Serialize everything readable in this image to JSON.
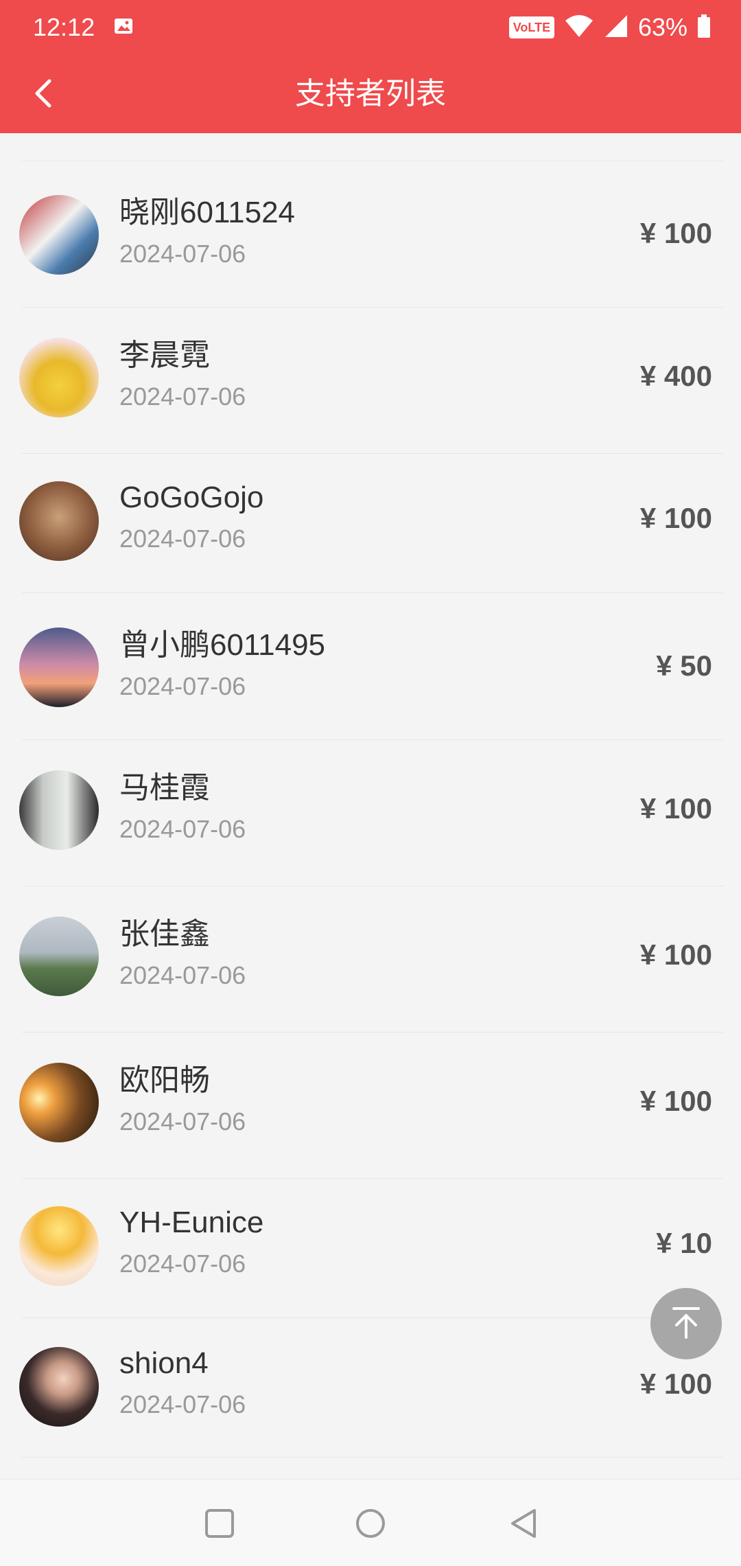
{
  "status_bar": {
    "time": "12:12",
    "network_badge": "VoLTE",
    "battery_percent": "63%",
    "icons": [
      "gallery-icon",
      "wifi-icon",
      "signal-icon",
      "battery-icon"
    ]
  },
  "header": {
    "title": "支持者列表",
    "back_icon": "back-chevron-icon"
  },
  "colors": {
    "brand_red": "#ef4a4c",
    "name_text": "#333333",
    "date_text": "#999999",
    "amount_text": "#555555"
  },
  "supporters": [
    {
      "name": "晓刚6011524",
      "date": "2024-07-06",
      "amount": "¥ 100"
    },
    {
      "name": "李晨霓",
      "date": "2024-07-06",
      "amount": "¥ 400"
    },
    {
      "name": "GoGoGojo",
      "date": "2024-07-06",
      "amount": "¥ 100"
    },
    {
      "name": "曾小鹏6011495",
      "date": "2024-07-06",
      "amount": "¥ 50"
    },
    {
      "name": "马桂霞",
      "date": "2024-07-06",
      "amount": "¥ 100"
    },
    {
      "name": "张佳鑫",
      "date": "2024-07-06",
      "amount": "¥ 100"
    },
    {
      "name": "欧阳畅",
      "date": "2024-07-06",
      "amount": "¥ 100"
    },
    {
      "name": "YH-Eunice",
      "date": "2024-07-06",
      "amount": "¥ 10"
    },
    {
      "name": "shion4",
      "date": "2024-07-06",
      "amount": "¥ 100"
    }
  ],
  "scroll_to_top_icon": "arrow-to-top-icon",
  "nav_bar": {
    "icons": [
      "recents-square-icon",
      "home-circle-icon",
      "back-triangle-icon"
    ]
  }
}
